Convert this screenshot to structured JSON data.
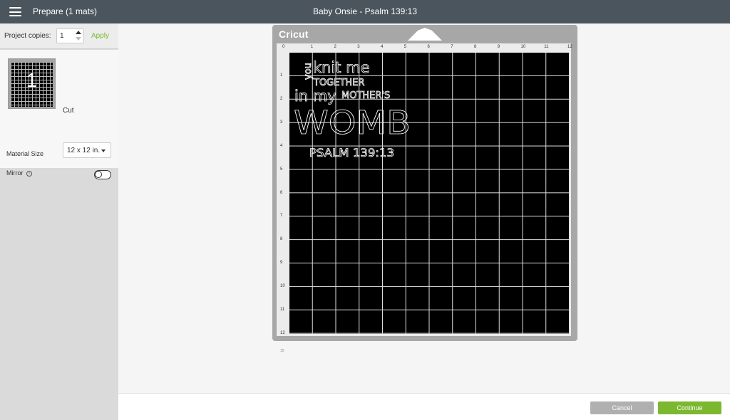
{
  "header": {
    "title": "Prepare (1 mats)",
    "project_name": "Baby Onsie - Psalm 139:13"
  },
  "left_panel": {
    "copies_label": "Project copies:",
    "copies_value": "1",
    "apply_label": "Apply",
    "mat": {
      "number": "1",
      "label": "Cut"
    },
    "material_size_label": "Material Size",
    "material_size_value": "12 x 12 in.",
    "mirror_label": "Mirror",
    "mirror_on": false
  },
  "mat": {
    "brand": "Cricut",
    "ruler_top": [
      "0",
      "1",
      "2",
      "3",
      "4",
      "5",
      "6",
      "7",
      "8",
      "9",
      "10",
      "11",
      "12"
    ],
    "ruler_left": [
      "1",
      "2",
      "3",
      "4",
      "5",
      "6",
      "7",
      "8",
      "9",
      "10",
      "11",
      "12"
    ],
    "design_lines": {
      "you": "you",
      "knit_me": "knit me",
      "together": "TOGETHER",
      "in_my": "in my",
      "mothers": "MOTHER'S",
      "womb": "WOMB",
      "psalm": "PSALM 139:13"
    },
    "below_mark": "15"
  },
  "footer": {
    "cancel_label": "Cancel",
    "continue_label": "Continue"
  },
  "colors": {
    "topbar": "#4b555d",
    "accent_green": "#7cb82f",
    "cancel_gray": "#b0b0b0"
  }
}
